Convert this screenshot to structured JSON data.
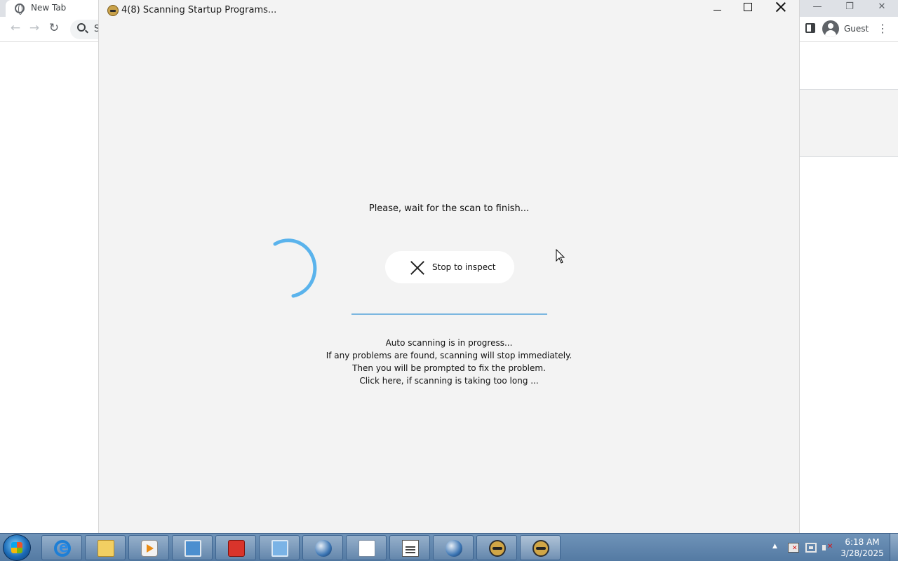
{
  "browser": {
    "tab_title": "New Tab",
    "omnibox_text": "S",
    "profile_label": "Guest",
    "minimize_glyph": "—",
    "restore_glyph": "❐",
    "close_glyph": "✕",
    "back_glyph": "←",
    "forward_glyph": "→",
    "reload_glyph": "↻",
    "menu_glyph": "⋮"
  },
  "dialog": {
    "title": "4(8) Scanning Startup Programs...",
    "wait_message": "Please, wait for the scan to finish...",
    "stop_button_label": "Stop to inspect",
    "info_lines": [
      "Auto scanning is in progress...",
      "If any problems are found, scanning will stop immediately.",
      "Then you will be prompted to fix the problem.",
      "Click here, if scanning is taking too long ..."
    ],
    "spinner_color": "#5ab3ec",
    "progress_color": "#7cb7e0"
  },
  "taskbar": {
    "items": [
      "internet-explorer-icon",
      "file-explorer-icon",
      "media-player-icon",
      "monitor-icon",
      "toolbox-icon",
      "remote-desktop-icon",
      "globe-icon",
      "document-icon",
      "text-editor-icon",
      "scanner-app-icon",
      "scanner-app-active-icon"
    ],
    "clock_time": "6:18 AM",
    "clock_date": "3/28/2025",
    "tray_arrow": "▲"
  }
}
